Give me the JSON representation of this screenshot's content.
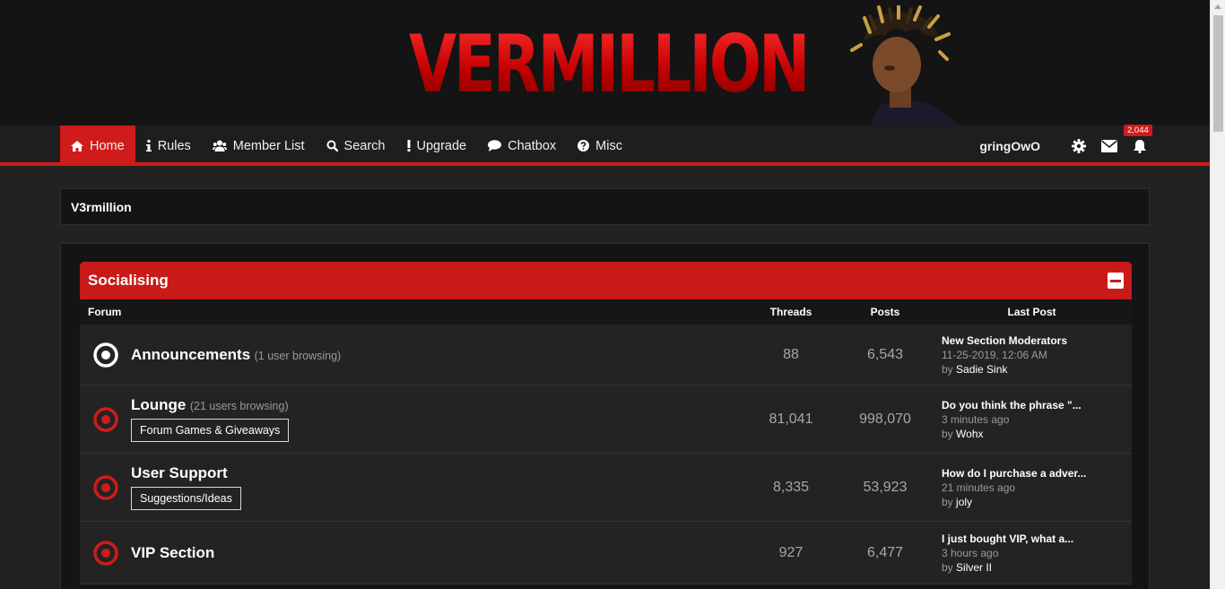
{
  "banner": {
    "logo_text": "VERMILLION"
  },
  "nav": {
    "items": [
      {
        "label": "Home",
        "icon": "home-icon"
      },
      {
        "label": "Rules",
        "icon": "info-icon"
      },
      {
        "label": "Member List",
        "icon": "users-icon"
      },
      {
        "label": "Search",
        "icon": "search-icon"
      },
      {
        "label": "Upgrade",
        "icon": "exclamation-icon"
      },
      {
        "label": "Chatbox",
        "icon": "chat-icon"
      },
      {
        "label": "Misc",
        "icon": "question-icon"
      }
    ],
    "username": "gringOwO",
    "notification_count": "2,044"
  },
  "breadcrumb": "V3rmillion",
  "category": {
    "title": "Socialising",
    "columns": {
      "forum": "Forum",
      "threads": "Threads",
      "posts": "Posts",
      "last_post": "Last Post"
    },
    "forums": [
      {
        "name": "Announcements",
        "browsing": "(1 user browsing)",
        "subforum": "",
        "threads": "88",
        "posts": "6,543",
        "last_title": "New Section Moderators",
        "last_time": "11-25-2019, 12:06 AM",
        "by": "by",
        "last_user": "Sadie Sink",
        "status": "read"
      },
      {
        "name": "Lounge",
        "browsing": "(21 users browsing)",
        "subforum": "Forum Games & Giveaways",
        "threads": "81,041",
        "posts": "998,070",
        "last_title": "Do you think the phrase \"...",
        "last_time": "3 minutes ago",
        "by": "by",
        "last_user": "Wohx",
        "status": "unread"
      },
      {
        "name": "User Support",
        "browsing": "",
        "subforum": "Suggestions/Ideas",
        "threads": "8,335",
        "posts": "53,923",
        "last_title": "How do I purchase a adver...",
        "last_time": "21 minutes ago",
        "by": "by",
        "last_user": "joly",
        "status": "unread"
      },
      {
        "name": "VIP Section",
        "browsing": "",
        "subforum": "",
        "threads": "927",
        "posts": "6,477",
        "last_title": "I just bought VIP, what a...",
        "last_time": "3 hours ago",
        "by": "by",
        "last_user": "Silver II",
        "status": "unread"
      }
    ]
  },
  "colors": {
    "accent": "#cf1b1b",
    "background": "#222222",
    "panel": "#141414"
  }
}
